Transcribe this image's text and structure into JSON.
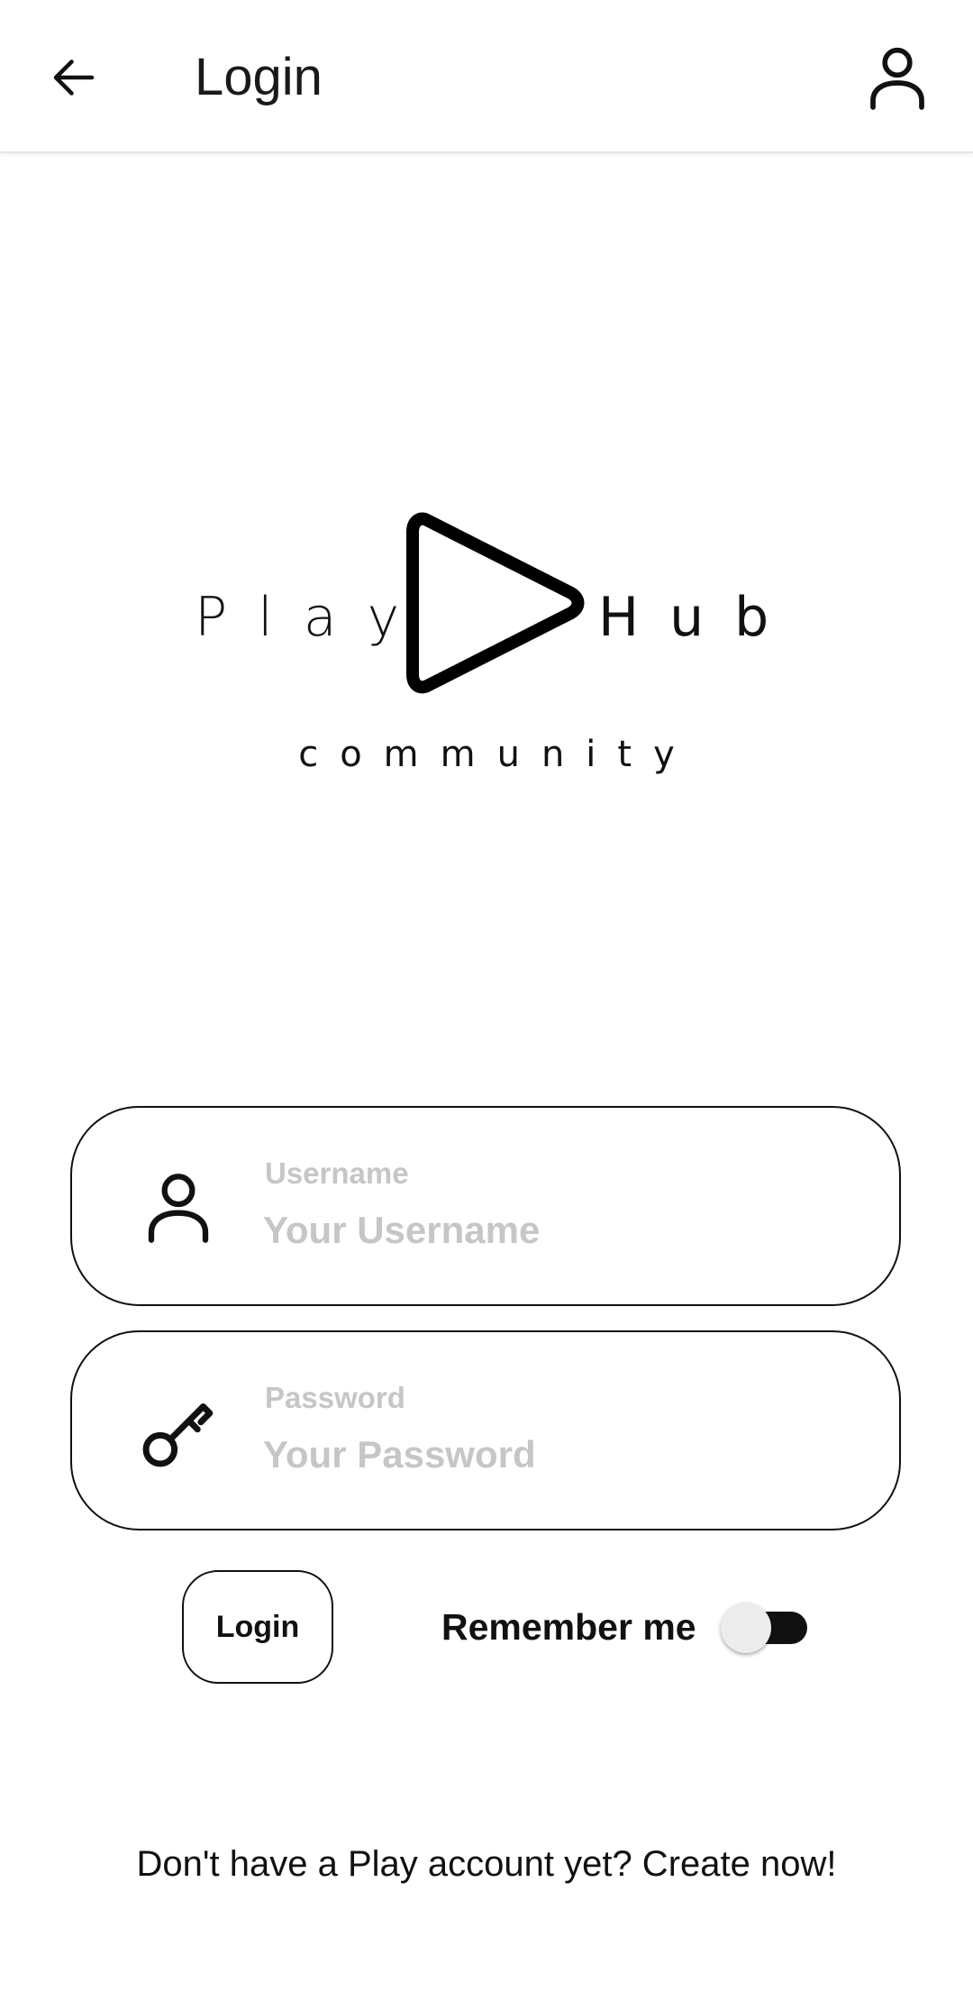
{
  "app_bar": {
    "title": "Login",
    "back_icon": "arrow-left-icon",
    "account_icon": "person-icon"
  },
  "logo": {
    "word_left": "Play",
    "word_right": "Hub",
    "subtitle": "community",
    "mark_icon": "play-triangle-icon"
  },
  "form": {
    "username": {
      "label": "Username",
      "placeholder": "Your Username",
      "value": "",
      "icon": "person-icon"
    },
    "password": {
      "label": "Password",
      "placeholder": "Your Password",
      "value": "",
      "icon": "key-icon"
    },
    "login_label": "Login",
    "remember_label": "Remember me",
    "remember_on": false
  },
  "footer": {
    "signup_text": "Don't have a Play account yet? Create now!"
  },
  "colors": {
    "text": "#111111",
    "placeholder": "#c6c6c6",
    "background": "#ffffff"
  }
}
